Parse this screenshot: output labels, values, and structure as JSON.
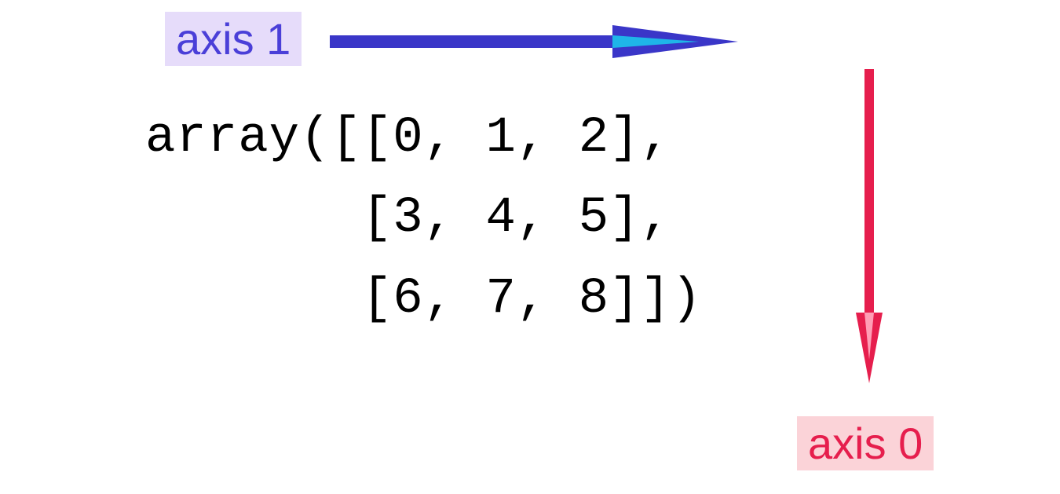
{
  "axis1": {
    "label": "axis 1",
    "color_text": "#4a3fd8",
    "color_bg": "#e6dcfa",
    "arrow_fill": "#3a36c8",
    "arrow_inner": "#1fb5e8"
  },
  "axis0": {
    "label": "axis 0",
    "color_text": "#e61e4d",
    "color_bg": "#fbd3d8",
    "arrow_fill": "#e61e4d"
  },
  "array": {
    "prefix": "array(",
    "rows": [
      [
        0,
        1,
        2
      ],
      [
        3,
        4,
        5
      ],
      [
        6,
        7,
        8
      ]
    ],
    "suffix": ")"
  },
  "code_text": "array([[0, 1, 2],\n       [3, 4, 5],\n       [6, 7, 8]])"
}
